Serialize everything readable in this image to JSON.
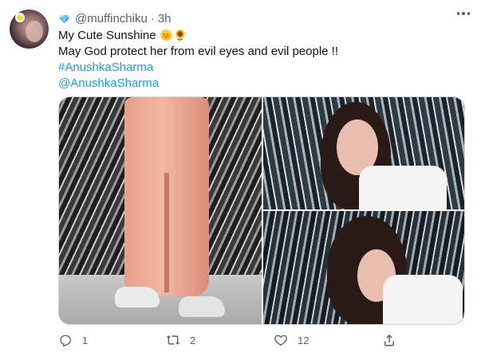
{
  "tweet": {
    "handle": "@muffinchiku",
    "separator": "·",
    "time": "3h",
    "line1_text": "My Cute Sunshine ",
    "line1_emoji": "🌞🌻",
    "line2": "May God protect her from evil eyes and evil people !!",
    "hashtag": "#AnushkaSharma",
    "mention": "@AnushkaSharma"
  },
  "media": {
    "count": 3,
    "alt": [
      "person in peach overalls and white sneakers",
      "smiling woman with long hair",
      "woman smiling looking down"
    ]
  },
  "actions": {
    "reply_count": "1",
    "retweet_count": "2",
    "like_count": "12",
    "share_count": ""
  },
  "icons": {
    "verified_style": "diamond-icon",
    "reply": "reply-icon",
    "retweet": "retweet-icon",
    "like": "heart-icon",
    "share": "share-icon",
    "more": "more-icon"
  },
  "colors": {
    "link": "#1d9bf0",
    "muted": "#536471",
    "text": "#0f1419",
    "diamond": "#49b6f0"
  }
}
